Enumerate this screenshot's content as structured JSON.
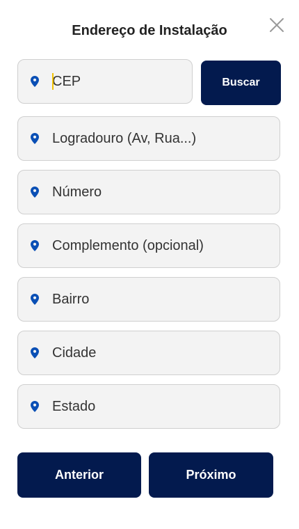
{
  "dialog": {
    "title": "Endereço de Instalação"
  },
  "colors": {
    "primary": "#031a4e",
    "pin": "#0a4fb5",
    "field_bg": "#f3f3f3",
    "field_border": "#cfcfcf",
    "caret": "#f2c200"
  },
  "icons": {
    "close": "close-icon",
    "field": "location-pin-icon"
  },
  "form": {
    "cep": {
      "placeholder": "CEP",
      "value": ""
    },
    "logradouro": {
      "placeholder": "Logradouro (Av, Rua...)",
      "value": ""
    },
    "numero": {
      "placeholder": "Número",
      "value": ""
    },
    "complemento": {
      "placeholder": "Complemento (opcional)",
      "value": ""
    },
    "bairro": {
      "placeholder": "Bairro",
      "value": ""
    },
    "cidade": {
      "placeholder": "Cidade",
      "value": ""
    },
    "estado": {
      "placeholder": "Estado",
      "value": ""
    }
  },
  "buttons": {
    "search_label": "Buscar",
    "previous_label": "Anterior",
    "next_label": "Próximo"
  }
}
